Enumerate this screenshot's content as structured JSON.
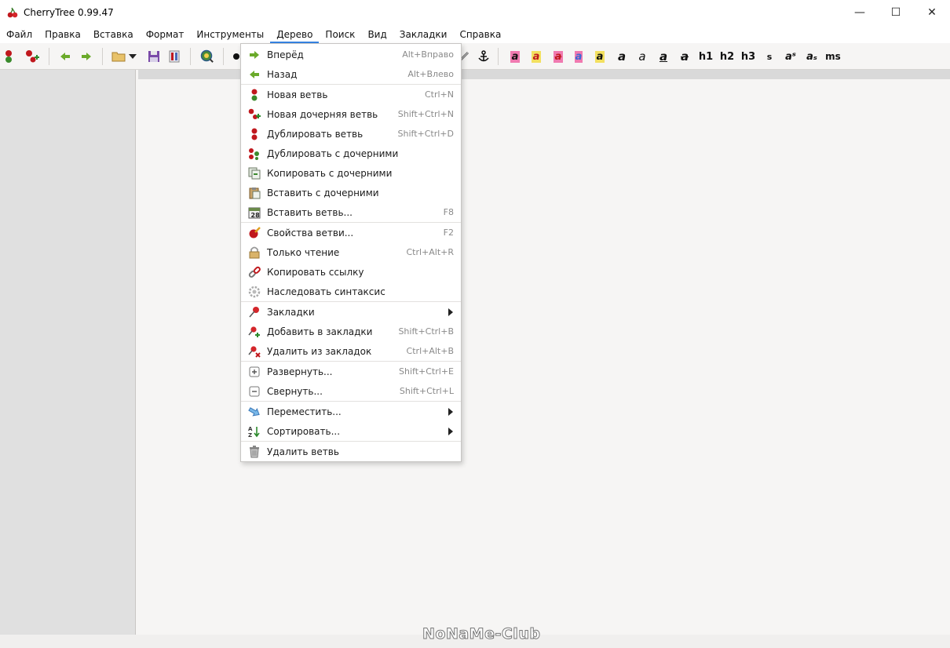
{
  "window": {
    "title": "CherryTree 0.99.47",
    "minimize": "—",
    "maximize": "☐",
    "close": "✕"
  },
  "menubar": {
    "items": [
      "Файл",
      "Правка",
      "Вставка",
      "Формат",
      "Инструменты",
      "Дерево",
      "Поиск",
      "Вид",
      "Закладки",
      "Справка"
    ],
    "active": "Дерево"
  },
  "toolbar": {
    "format_buttons": [
      "a",
      "a",
      "a",
      "a",
      "a",
      "a",
      "a",
      "a",
      "a",
      "h1",
      "h2",
      "h3",
      "s",
      "aˢ",
      "aₛ",
      "ms"
    ]
  },
  "tree_menu": {
    "items": [
      {
        "label": "Вперёд",
        "shortcut": "Alt+Вправо",
        "icon": "arrow-right-icon"
      },
      {
        "label": "Назад",
        "shortcut": "Alt+Влево",
        "icon": "arrow-left-icon"
      },
      {
        "label": "Новая ветвь",
        "shortcut": "Ctrl+N",
        "icon": "cherry-node-icon"
      },
      {
        "label": "Новая дочерняя ветвь",
        "shortcut": "Shift+Ctrl+N",
        "icon": "cherry-child-add-icon"
      },
      {
        "label": "Дублировать ветвь",
        "shortcut": "Shift+Ctrl+D",
        "icon": "cherry-duplicate-icon"
      },
      {
        "label": "Дублировать с дочерними",
        "shortcut": "",
        "icon": "cherries-icon"
      },
      {
        "label": "Копировать с дочерними",
        "shortcut": "",
        "icon": "copy-icon"
      },
      {
        "label": "Вставить с дочерними",
        "shortcut": "",
        "icon": "paste-icon"
      },
      {
        "label": "Вставить ветвь...",
        "shortcut": "F8",
        "icon": "calendar-icon"
      },
      {
        "label": "Свойства ветви...",
        "shortcut": "F2",
        "icon": "cherry-edit-icon"
      },
      {
        "label": "Только чтение",
        "shortcut": "Ctrl+Alt+R",
        "icon": "lock-icon"
      },
      {
        "label": "Копировать ссылку",
        "shortcut": "",
        "icon": "link-icon"
      },
      {
        "label": "Наследовать синтаксис",
        "shortcut": "",
        "icon": "gear-icon"
      },
      {
        "label": "Закладки",
        "shortcut": "",
        "icon": "pin-icon",
        "submenu": true
      },
      {
        "label": "Добавить в закладки",
        "shortcut": "Shift+Ctrl+B",
        "icon": "pin-add-icon"
      },
      {
        "label": "Удалить из закладок",
        "shortcut": "Ctrl+Alt+B",
        "icon": "pin-remove-icon"
      },
      {
        "label": "Развернуть...",
        "shortcut": "Shift+Ctrl+E",
        "icon": "expand-icon"
      },
      {
        "label": "Свернуть...",
        "shortcut": "Shift+Ctrl+L",
        "icon": "collapse-icon"
      },
      {
        "label": "Переместить...",
        "shortcut": "",
        "icon": "move-icon",
        "submenu": true
      },
      {
        "label": "Сортировать...",
        "shortcut": "",
        "icon": "sort-icon",
        "submenu": true
      },
      {
        "label": "Удалить ветвь",
        "shortcut": "",
        "icon": "trash-icon"
      }
    ]
  },
  "watermark": "NoNaMe-Club"
}
